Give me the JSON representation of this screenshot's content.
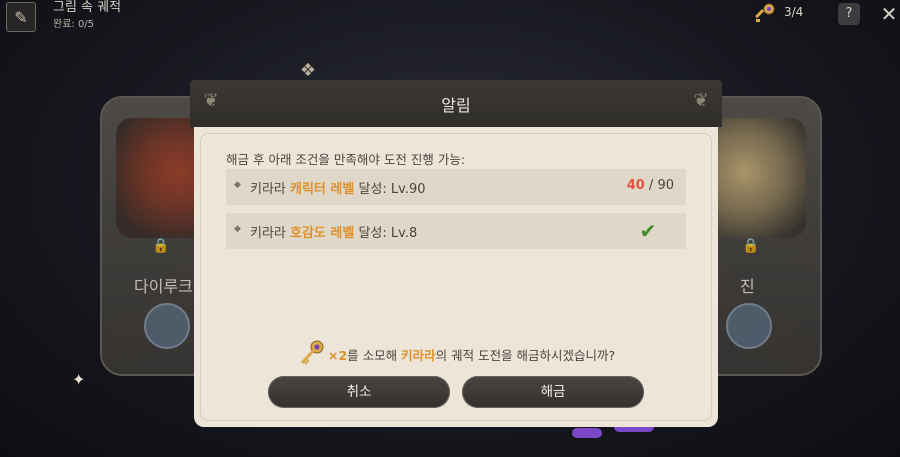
{
  "top_bar": {
    "title": "그림 속 궤적",
    "progress": "완료: 0/5",
    "key_count": "3/4",
    "help_label": "?",
    "close_label": "✕"
  },
  "cards": {
    "left_name": "다이루크",
    "right_name": "진"
  },
  "dialog": {
    "title": "알림",
    "intro": "해금 후 아래 조건을 만족해야 도전 진행 가능:",
    "conditions": [
      {
        "prefix": "키라라 ",
        "highlight": "캐릭터 레벨",
        "suffix": " 달성: Lv.90",
        "current": "40",
        "separator": " / ",
        "required": "90",
        "met": false
      },
      {
        "prefix": "키라라 ",
        "highlight": "호감도 레벨",
        "suffix": " 달성: Lv.8",
        "met": true
      }
    ],
    "confirm": {
      "cost": "×2",
      "text1": "를 소모해 ",
      "name": "키라라",
      "text2": "의 궤적 도전을 해금하시겠습니까?"
    },
    "cancel_label": "취소",
    "confirm_label": "해금"
  },
  "icons": {
    "key": "golden-key-icon",
    "lock": "lock-icon",
    "check": "checkmark-icon",
    "diamond": "diamond-bullet-icon"
  },
  "colors": {
    "highlight": "#e0912b",
    "progress_current": "#e0563f",
    "check": "#3f8c2f",
    "dialog_bg": "#ece5d8",
    "button_bg": "#3b3835"
  }
}
